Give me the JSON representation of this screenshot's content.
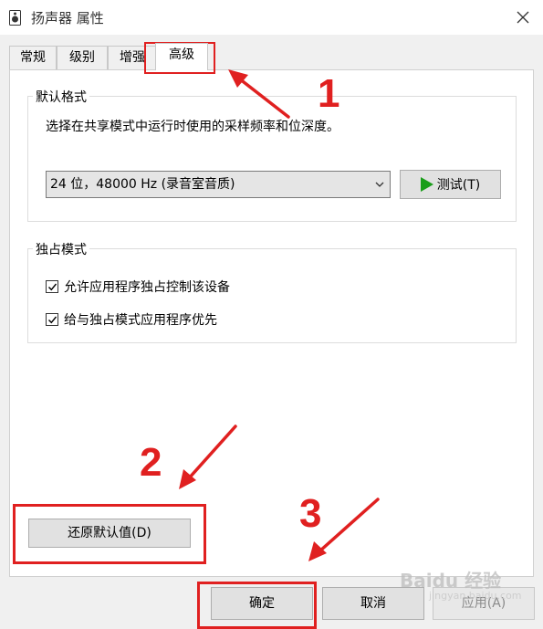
{
  "window": {
    "title": "扬声器 属性",
    "icon": "speaker-icon"
  },
  "tabs": [
    {
      "label": "常规"
    },
    {
      "label": "级别"
    },
    {
      "label": "增强"
    },
    {
      "label": "高级",
      "active": true
    }
  ],
  "default_format": {
    "group_label": "默认格式",
    "description": "选择在共享模式中运行时使用的采样频率和位深度。",
    "selected_format": "24 位，48000 Hz (录音室音质)",
    "test_label": "测试(T)"
  },
  "exclusive_mode": {
    "group_label": "独占模式",
    "options": [
      {
        "label": "允许应用程序独占控制该设备",
        "checked": true
      },
      {
        "label": "给与独占模式应用程序优先",
        "checked": true
      }
    ]
  },
  "restore_label": "还原默认值(D)",
  "footer": {
    "ok_label": "确定",
    "cancel_label": "取消",
    "apply_label": "应用(A)"
  },
  "annotations": {
    "step1": "1",
    "step2": "2",
    "step3": "3",
    "color": "#e02020"
  },
  "watermark": {
    "brand": "Baidu 经验",
    "url": "jingyan.baidu.com"
  },
  "colors": {
    "dialog_bg": "#f0f0f0",
    "panel_bg": "#ffffff",
    "play_icon": "#1a9e1a"
  }
}
